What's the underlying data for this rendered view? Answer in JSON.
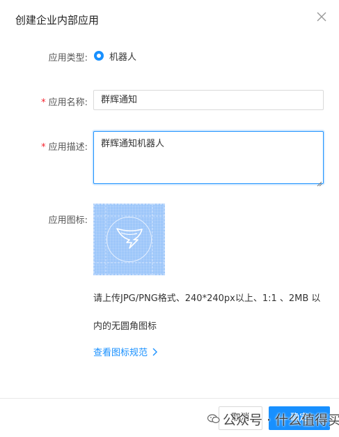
{
  "dialog": {
    "title": "创建企业内部应用"
  },
  "form": {
    "type": {
      "label": "应用类型:",
      "option": "机器人"
    },
    "name": {
      "required_mark": "*",
      "label": "应用名称:",
      "value": "群辉通知"
    },
    "description": {
      "required_mark": "*",
      "label": "应用描述:",
      "value": "群辉通知机器人"
    },
    "icon": {
      "label": "应用图标:",
      "hint_line1": "请上传JPG/PNG格式、240*240px以上、1:1 、2MB 以",
      "hint_line2": "内的无圆角图标",
      "spec_link": "查看图标规范"
    }
  },
  "footer": {
    "cancel_label": "取消",
    "ok_label": "确定"
  },
  "watermark": {
    "text": "公众号 · 什么值得买"
  },
  "icons": {
    "close": "close-icon",
    "chevron": "chevron-right-icon",
    "app_logo": "dingtalk-logo"
  },
  "colors": {
    "accent": "#1890ff",
    "required": "#f5222d",
    "upload_bg": "#a8cdfb"
  }
}
